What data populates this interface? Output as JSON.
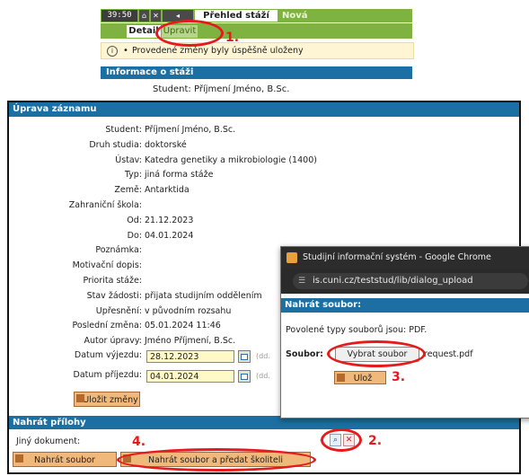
{
  "top": {
    "time": "39:50",
    "tab_active": "Přehled stáží",
    "tab_other": "Nová",
    "subtab_detail": "Detail",
    "subtab_edit": "Upravit",
    "message": "Provedené změny byly úspěšně uloženy",
    "info_heading": "Informace o stáži",
    "student_label": "Student:",
    "student_value": "Příjmení Jméno, B.Sc."
  },
  "form": {
    "heading": "Úprava záznamu",
    "fields": [
      {
        "label": "Student:",
        "value": "Příjmení Jméno, B.Sc."
      },
      {
        "label": "Druh studia:",
        "value": "doktorské"
      },
      {
        "label": "Ústav:",
        "value": "Katedra genetiky a mikrobiologie (1400)"
      },
      {
        "label": "Typ:",
        "value": "jiná forma stáže"
      },
      {
        "label": "Země:",
        "value": "Antarktida"
      },
      {
        "label": "Zahraniční škola:",
        "value": ""
      },
      {
        "label": "Od:",
        "value": "21.12.2023"
      },
      {
        "label": "Do:",
        "value": "04.01.2024"
      },
      {
        "label": "Poznámka:",
        "value": ""
      },
      {
        "label": "Motivační dopis:",
        "value": ""
      },
      {
        "label": "Priorita stáže:",
        "value": ""
      },
      {
        "label": "Stav žádosti:",
        "value": "přijata studijním oddělením"
      },
      {
        "label": "Upřesnění:",
        "value": "v původním rozsahu"
      },
      {
        "label": "Poslední změna:",
        "value": "05.01.2024 11:46"
      },
      {
        "label": "Autor úpravy:",
        "value": "Jméno Příjmení, B.Sc."
      }
    ],
    "departure_label": "Datum výjezdu:",
    "departure_value": "28.12.2023",
    "arrival_label": "Datum příjezdu:",
    "arrival_value": "04.01.2024",
    "date_hint": "(dd.",
    "save_button": "Uložit změny"
  },
  "upload": {
    "heading": "Nahrát přílohy",
    "doc_label": "Jiný dokument:",
    "dash": "-",
    "upload_button": "Nahrát soubor",
    "upload_submit_button": "Nahrát soubor a předat školiteli"
  },
  "popup": {
    "window_title": "Studijní informační systém - Google Chrome",
    "url": "is.cuni.cz/teststud/lib/dialog_upload",
    "heading": "Nahrát soubor:",
    "allowed": "Povolené typy souborů jsou: PDF.",
    "file_label": "Soubor:",
    "choose_button": "Vybrat soubor",
    "file_name": "request.pdf",
    "save_button": "Ulož"
  },
  "annotations": {
    "n1": "1.",
    "n2": "2.",
    "n3": "3.",
    "n4": "4."
  },
  "colors": {
    "accent_blue": "#1b6fa3",
    "tab_green": "#7fb341",
    "annotation_red": "#e51b1b",
    "input_yellow": "#fff9c8"
  }
}
